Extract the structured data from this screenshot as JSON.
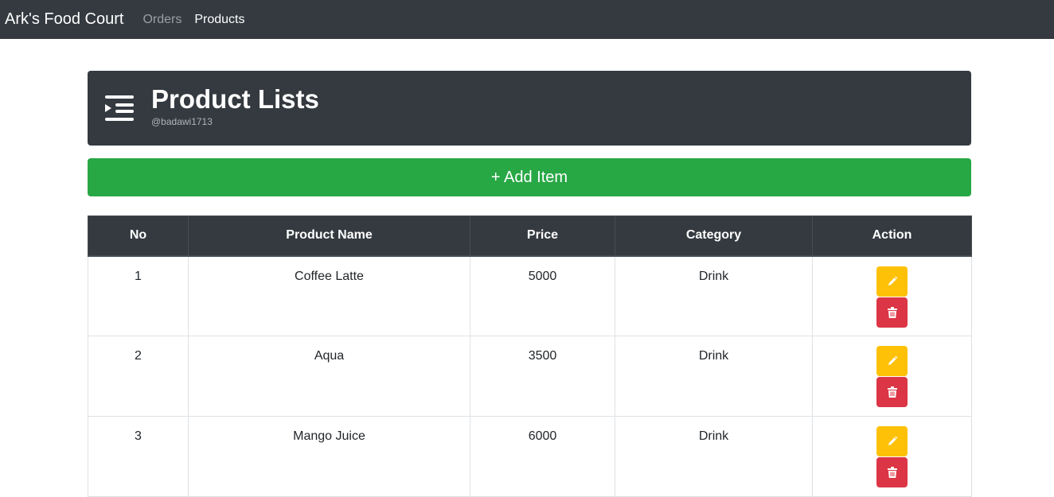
{
  "navbar": {
    "brand": "Ark's Food Court",
    "links": [
      {
        "label": "Orders",
        "active": false
      },
      {
        "label": "Products",
        "active": true
      }
    ]
  },
  "header": {
    "icon": "indent-list-icon",
    "title": "Product Lists",
    "subtitle": "@badawi1713"
  },
  "add_button": {
    "label": "+ Add Item"
  },
  "table": {
    "columns": [
      "No",
      "Product Name",
      "Price",
      "Category",
      "Action"
    ],
    "rows": [
      {
        "no": "1",
        "name": "Coffee Latte",
        "price": "5000",
        "category": "Drink"
      },
      {
        "no": "2",
        "name": "Aqua",
        "price": "3500",
        "category": "Drink"
      },
      {
        "no": "3",
        "name": "Mango Juice",
        "price": "6000",
        "category": "Drink"
      }
    ],
    "action_icons": {
      "edit": "pencil-icon",
      "delete": "trash-icon"
    }
  },
  "colors": {
    "dark": "#343a40",
    "success": "#28a745",
    "warning": "#ffc107",
    "danger": "#dc3545"
  }
}
